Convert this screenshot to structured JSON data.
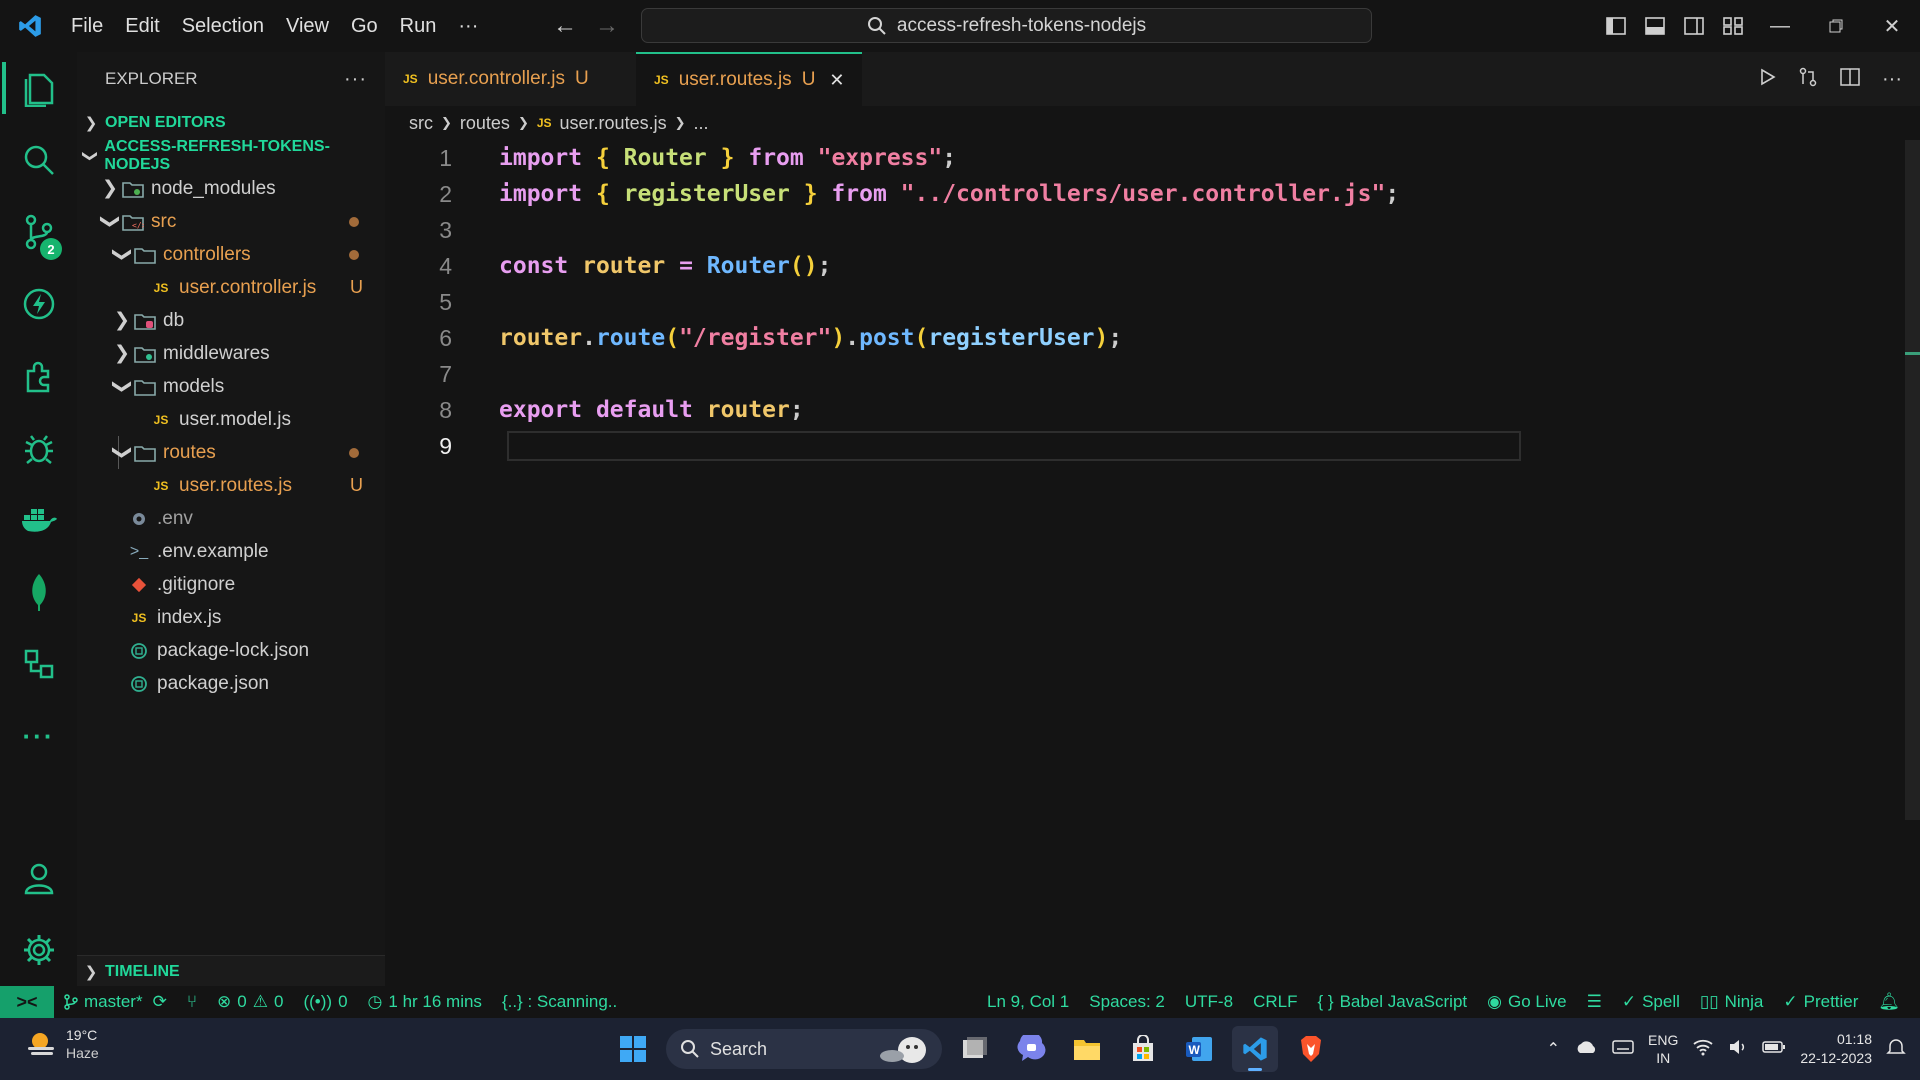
{
  "menu": [
    "File",
    "Edit",
    "Selection",
    "View",
    "Go",
    "Run",
    "···"
  ],
  "command_center": "access-refresh-tokens-nodejs",
  "activity": {
    "source_control_badge": "2"
  },
  "explorer": {
    "title": "EXPLORER",
    "more": "···",
    "open_editors": "OPEN EDITORS",
    "project": "ACCESS-REFRESH-TOKENS-NODEJS",
    "items": [
      {
        "label": "node_modules",
        "git": ""
      },
      {
        "label": "src",
        "git": "dot"
      },
      {
        "label": "controllers",
        "git": "dot"
      },
      {
        "label": "user.controller.js",
        "git": "U"
      },
      {
        "label": "db",
        "git": ""
      },
      {
        "label": "middlewares",
        "git": ""
      },
      {
        "label": "models",
        "git": ""
      },
      {
        "label": "user.model.js",
        "git": ""
      },
      {
        "label": "routes",
        "git": "dot"
      },
      {
        "label": "user.routes.js",
        "git": "U"
      },
      {
        "label": ".env",
        "git": ""
      },
      {
        "label": ".env.example",
        "git": ""
      },
      {
        "label": ".gitignore",
        "git": ""
      },
      {
        "label": "index.js",
        "git": ""
      },
      {
        "label": "package-lock.json",
        "git": ""
      },
      {
        "label": "package.json",
        "git": ""
      }
    ],
    "timeline": "TIMELINE",
    "js_tag": "JS"
  },
  "tabs": [
    {
      "label": "user.controller.js",
      "status": "U"
    },
    {
      "label": "user.routes.js",
      "status": "U"
    }
  ],
  "breadcrumb": [
    "src",
    "routes",
    "user.routes.js",
    "..."
  ],
  "code": {
    "line_numbers": [
      "1",
      "2",
      "3",
      "4",
      "5",
      "6",
      "7",
      "8",
      "9"
    ],
    "l1": {
      "kw": "import",
      "ob": "{",
      "name": "Router",
      "cb": "}",
      "from": "from",
      "str": "\"express\"",
      "semi": ";"
    },
    "l2": {
      "kw": "import",
      "ob": "{",
      "name": "registerUser",
      "cb": "}",
      "from": "from",
      "str": "\"../controllers/user.controller.js\"",
      "semi": ";"
    },
    "l4": {
      "kw": "const",
      "var": "router",
      "eq": "=",
      "fn": "Router",
      "parens": "()",
      "semi": ";"
    },
    "l6": {
      "obj": "router",
      "dot1": ".",
      "route": "route",
      "op1": "(",
      "str": "\"/register\"",
      "cp1": ")",
      "dot2": ".",
      "post": "post",
      "op2": "(",
      "arg": "registerUser",
      "cp2": ")",
      "semi": ";"
    },
    "l8": {
      "kw1": "export",
      "kw2": "default",
      "var": "router",
      "semi": ";"
    }
  },
  "status": {
    "branch": "master*",
    "errors": "0",
    "warnings": "0",
    "ports": "0",
    "time": "1 hr 16 mins",
    "scanning": "{..} : Scanning..",
    "position": "Ln 9, Col 1",
    "spaces": "Spaces: 2",
    "encoding": "UTF-8",
    "eol": "CRLF",
    "language": "Babel JavaScript",
    "golive": "Go Live",
    "spell": "Spell",
    "ninja": "Ninja",
    "prettier": "Prettier"
  },
  "taskbar": {
    "temp": "19°C",
    "condition": "Haze",
    "search": "Search",
    "lang1": "ENG",
    "lang2": "IN",
    "time": "01:18",
    "date": "22-12-2023"
  },
  "colors": {
    "accent": "#22c08a",
    "modified": "#e8a050",
    "keyword": "#e89ef0",
    "string": "#f07fa2"
  }
}
